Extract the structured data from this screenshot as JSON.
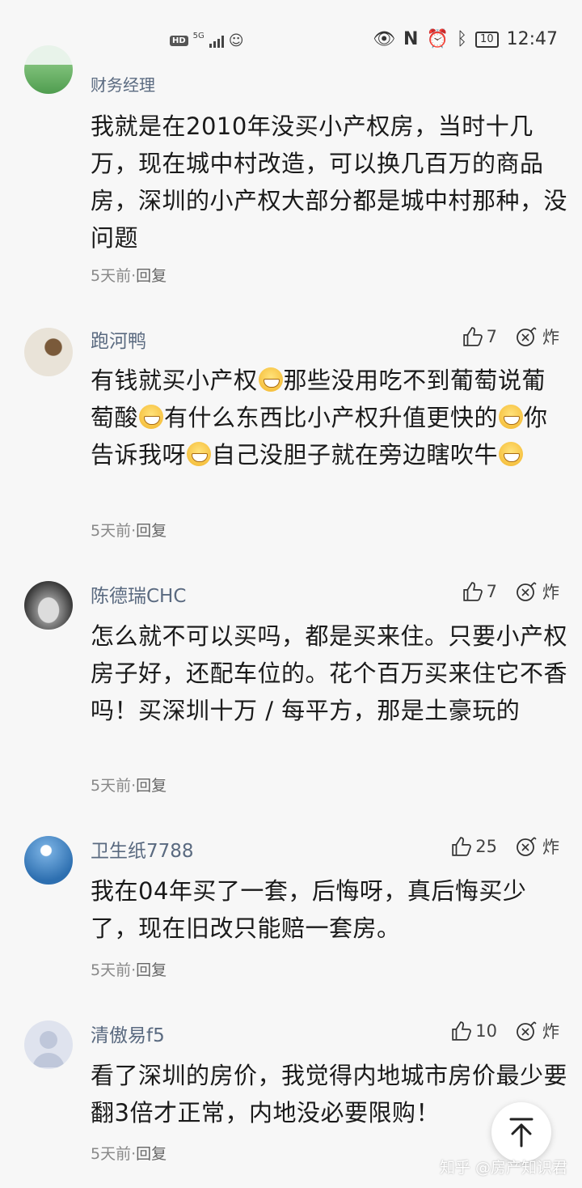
{
  "status_bar": {
    "hd": "HD",
    "network": "5G",
    "battery": "10",
    "time": "12:47"
  },
  "comments": [
    {
      "username": "财务经理",
      "text": "我就是在2010年没买小产权房，当时十几万，现在城中村改造，可以换几百万的商品房，深圳的小产权大部分都是城中村那种，没问题",
      "time": "5天前",
      "reply": "回复"
    },
    {
      "username": "跑河鸭",
      "likes": "7",
      "bomb": "炸",
      "text_parts": [
        "有钱就买小产权",
        "那些没用吃不到葡萄说葡萄酸",
        "有什么东西比小产权升值更快的",
        "你告诉我呀",
        "自己没胆子就在旁边瞎吹牛"
      ],
      "time": "5天前",
      "reply": "回复"
    },
    {
      "username": "陈德瑞CHC",
      "likes": "7",
      "bomb": "炸",
      "text": "怎么就不可以买吗，都是买来住。只要小产权房子好，还配车位的。花个百万买来住它不香吗！买深圳十万 / 每平方，那是土豪玩的",
      "time": "5天前",
      "reply": "回复"
    },
    {
      "username": "卫生纸7788",
      "likes": "25",
      "bomb": "炸",
      "text": "我在04年买了一套，后悔呀，真后悔买少了，现在旧改只能赔一套房。",
      "time": "5天前",
      "reply": "回复"
    },
    {
      "username": "清傲易f5",
      "likes": "10",
      "bomb": "炸",
      "text": "看了深圳的房价，我觉得内地城市房价最少要翻3倍才正常，内地没必要限购！",
      "time": "5天前",
      "reply": "回复"
    }
  ],
  "watermark": "知乎 @房产知识君",
  "icons": {
    "like": "thumbs-up-icon",
    "bomb": "bomb-icon",
    "back_to_top": "arrow-up-icon",
    "emoji": "grin-emoji-icon"
  }
}
